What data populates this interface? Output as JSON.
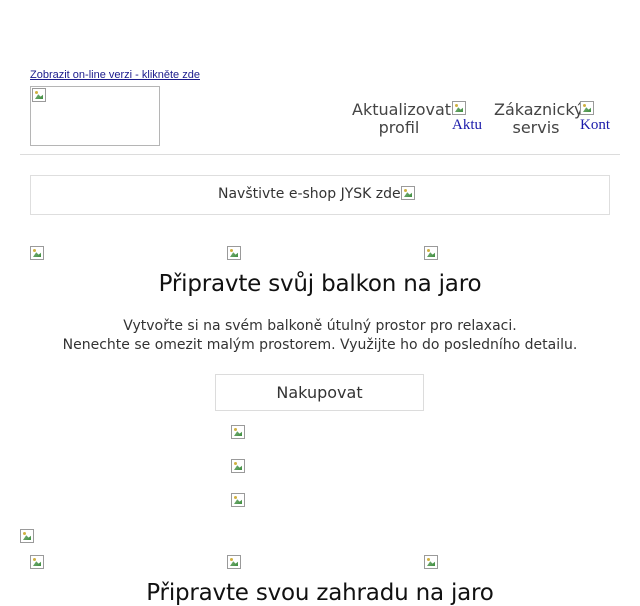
{
  "header": {
    "online_link": "Zobrazit on-line verzi - klikněte zde",
    "update_profile": [
      "Aktualizovat",
      "profil"
    ],
    "update_profile_alt": "Aktu",
    "customer_service": [
      "Zákaznický",
      "servis"
    ],
    "customer_service_alt": "Kont"
  },
  "eshop": {
    "label": "Navštivte e-shop JYSK zde"
  },
  "section1": {
    "title": "Připravte svůj balkon na jaro",
    "lines": [
      "Vytvořte si na svém balkoně útulný prostor pro relaxaci.",
      "Nenechte se omezit malým prostorem. Využijte ho do posledního detailu."
    ],
    "button": "Nakupovat"
  },
  "section2": {
    "title": "Připravte svou zahradu na jaro"
  }
}
